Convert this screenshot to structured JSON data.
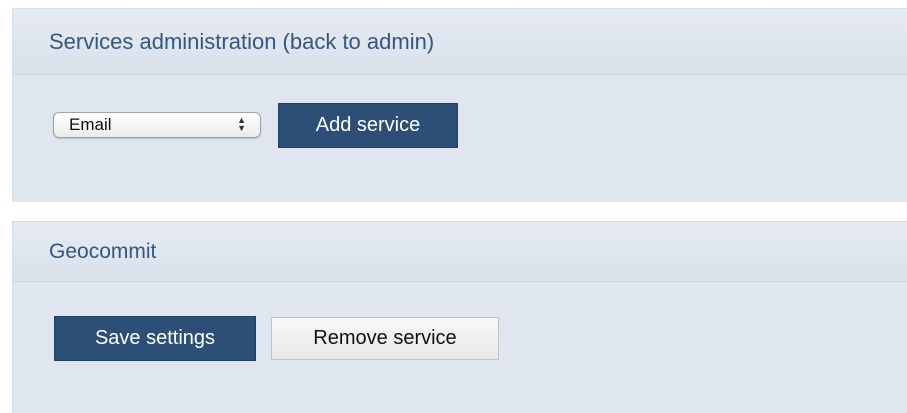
{
  "services_panel": {
    "title": "Services administration (back to admin)",
    "service_select": {
      "selected": "Email"
    },
    "add_button_label": "Add service"
  },
  "geocommit_panel": {
    "title": "Geocommit",
    "save_button_label": "Save settings",
    "remove_button_label": "Remove service"
  },
  "colors": {
    "panel_background": "#dfe6ef",
    "header_text": "#33577e",
    "primary_button": "#2d4f77"
  },
  "icons": {
    "select_arrows": "up-down-chevron-icon"
  }
}
